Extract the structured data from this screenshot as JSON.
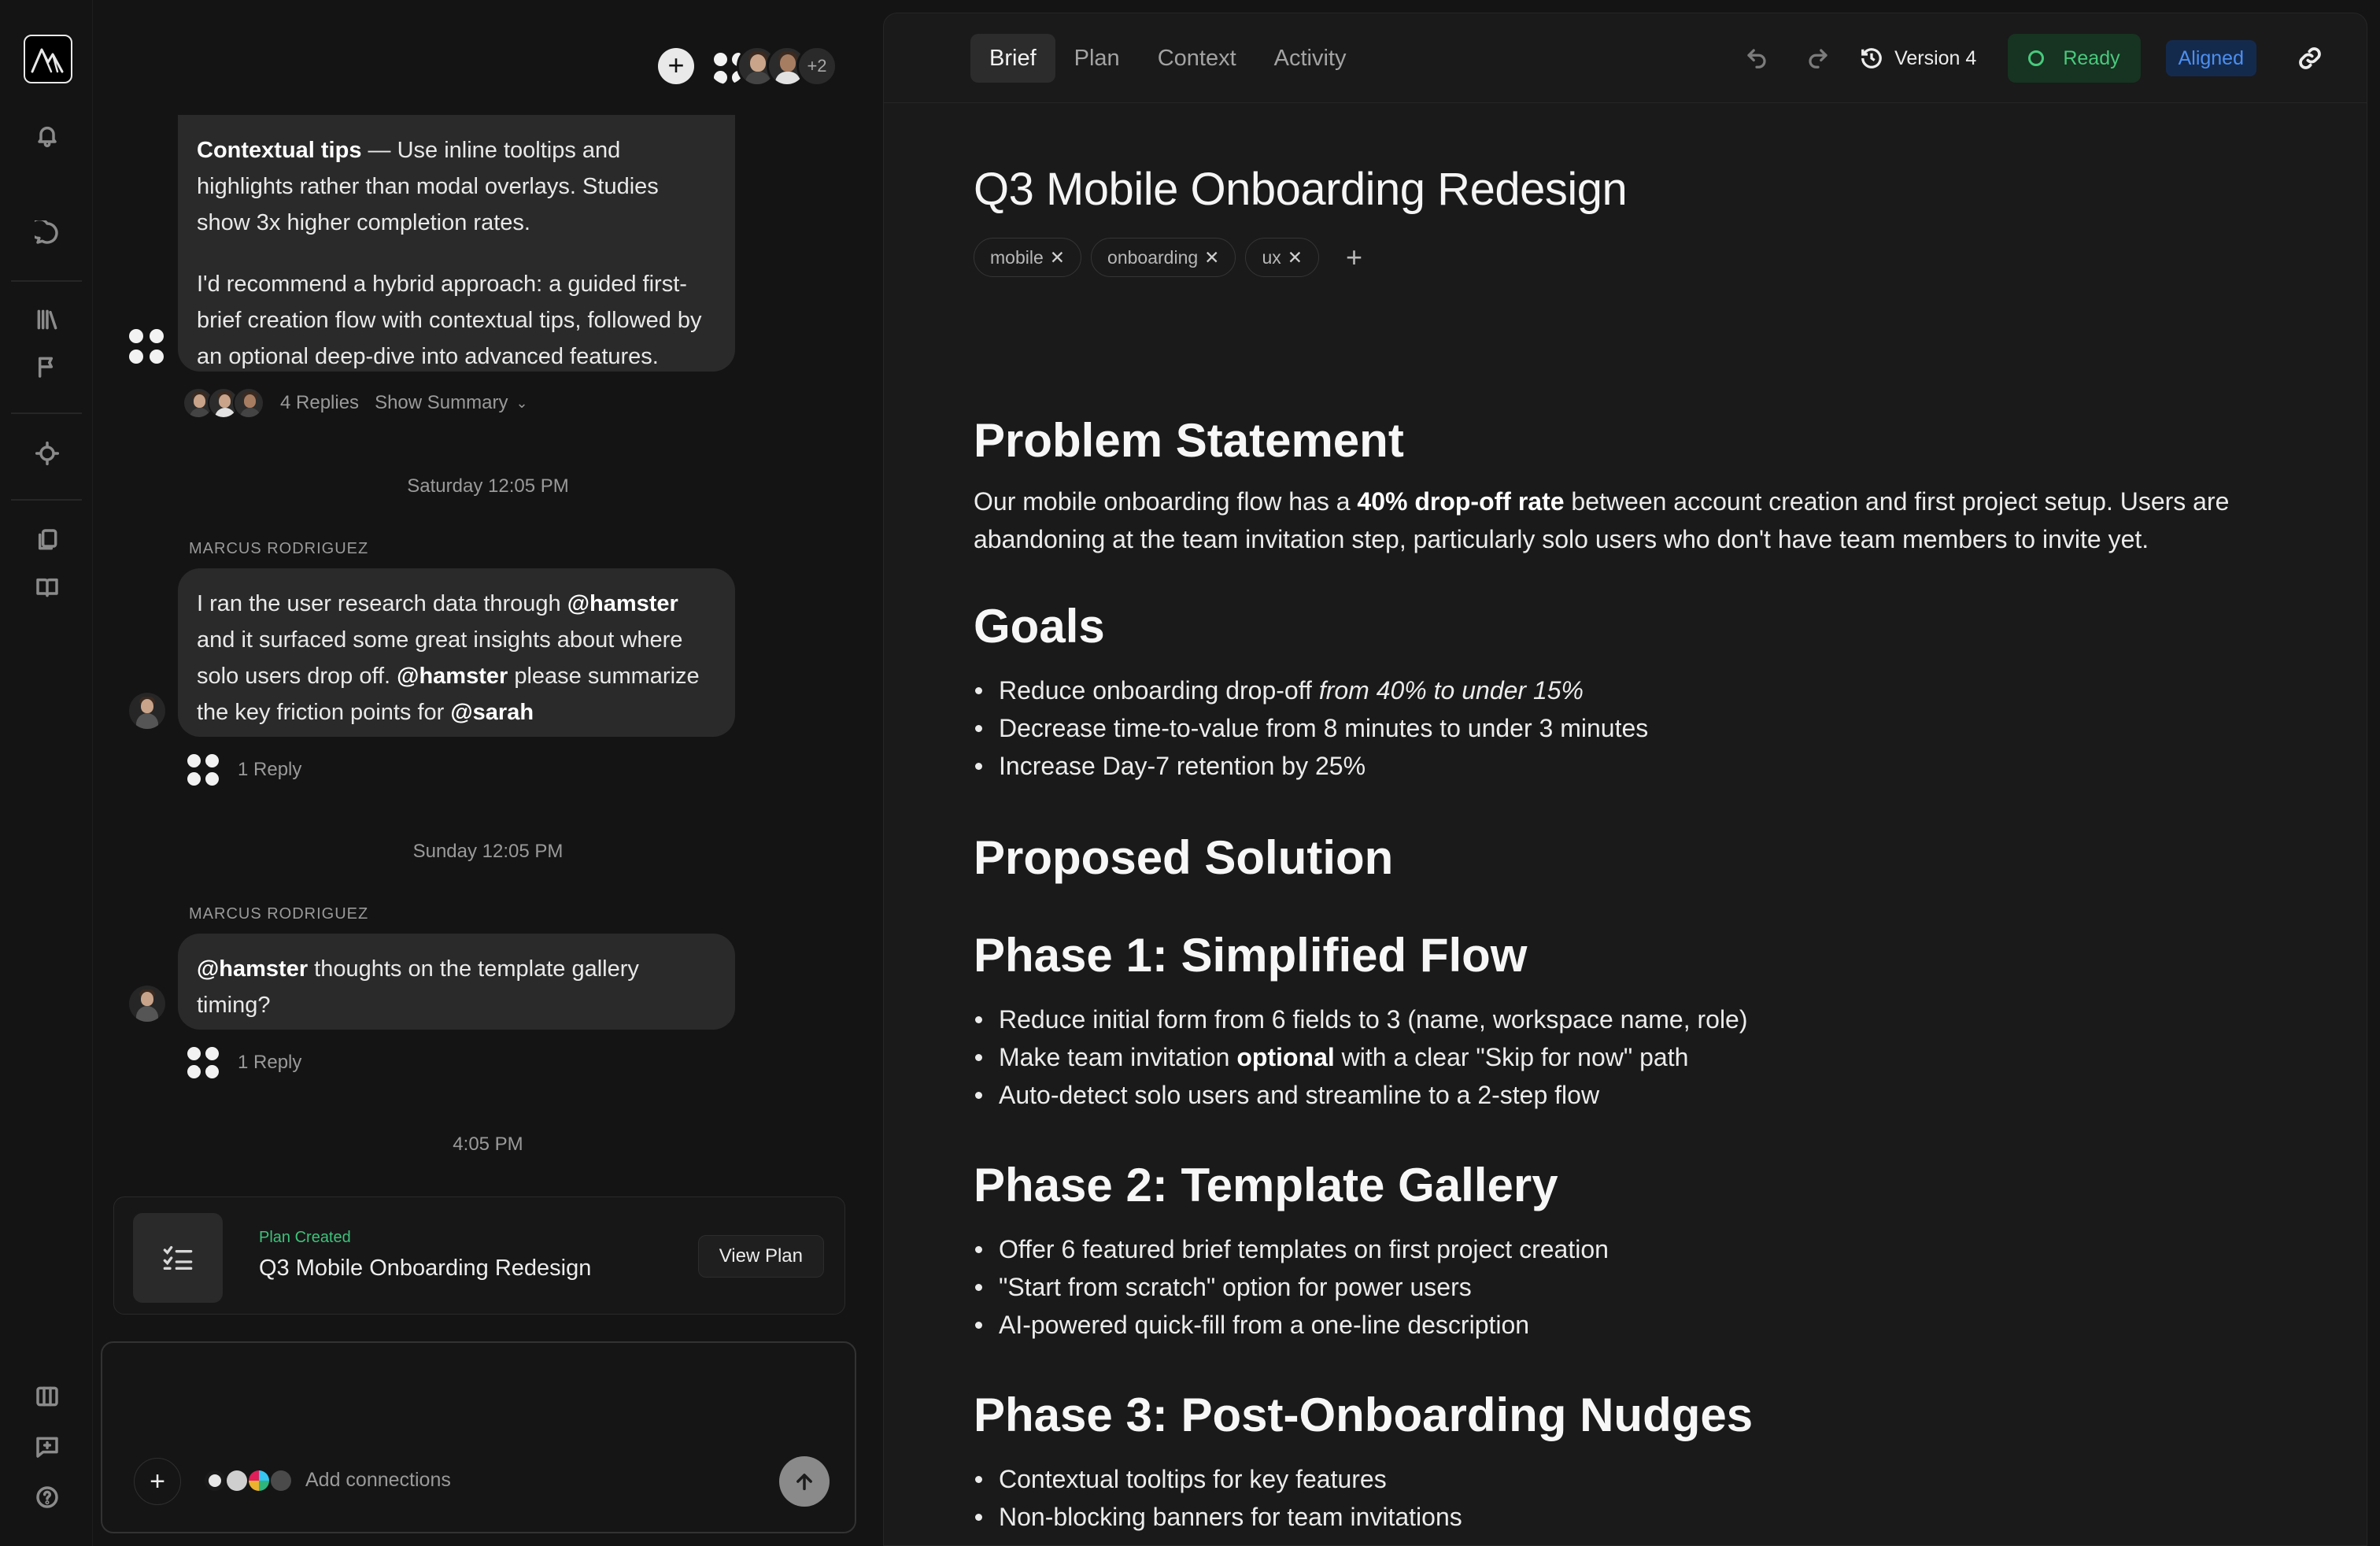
{
  "chat": {
    "extra_collaborators": "+2",
    "messages": [
      {
        "p1_bold": "Contextual tips",
        "p1_rest": " — Use inline tooltips and highlights rather than modal overlays. Studies show 3x higher completion rates.",
        "p2": "I'd recommend a hybrid approach: a guided first-brief creation flow with contextual tips, followed by an optional deep-dive into advanced features.",
        "replies": "4 Replies",
        "summary": "Show Summary"
      }
    ],
    "date1": "Saturday 12:05 PM",
    "sender1": "MARCUS RODRIGUEZ",
    "msg2": {
      "t1": "I ran the user research data through ",
      "m1": "@hamster",
      "t2": " and it surfaced some great insights about where solo users drop off. ",
      "m2": "@hamster",
      "t3": " please summarize the key friction points for ",
      "m3": "@sarah"
    },
    "reply2": "1 Reply",
    "date2": "Sunday 12:05 PM",
    "sender2": "MARCUS RODRIGUEZ",
    "msg3": {
      "m1": "@hamster",
      "t1": " thoughts on the template gallery timing?"
    },
    "reply3": "1 Reply",
    "date3": "4:05 PM",
    "plan_card": {
      "kicker": "Plan Created",
      "title": "Q3 Mobile Onboarding Redesign",
      "button": "View Plan"
    },
    "composer": {
      "placeholder": "Add connections"
    }
  },
  "doc": {
    "tabs": [
      "Brief",
      "Plan",
      "Context",
      "Activity"
    ],
    "version": "Version 4",
    "status": "Ready",
    "alignment": "Aligned",
    "title": "Q3 Mobile Onboarding Redesign",
    "tags": [
      "mobile",
      "onboarding",
      "ux"
    ],
    "problem": {
      "heading": "Problem Statement",
      "t1": "Our mobile onboarding flow has a ",
      "b1": "40% drop-off rate",
      "t2": " between account creation and first project setup. Users are abandoning at the team invitation step, particularly solo users who don't have team members to invite yet."
    },
    "goals": {
      "heading": "Goals",
      "g1a": "Reduce onboarding drop-off ",
      "g1b": "from 40% to under 15%",
      "g2": "Decrease time-to-value from 8 minutes to under 3 minutes",
      "g3": "Increase Day-7 retention by 25%"
    },
    "solution_heading": "Proposed Solution",
    "phase1": {
      "heading": "Phase 1: Simplified Flow",
      "i1": "Reduce initial form from 6 fields to 3 (name, workspace name, role)",
      "i2a": "Make team invitation ",
      "i2b": "optional",
      "i2c": " with a clear \"Skip for now\" path",
      "i3": "Auto-detect solo users and streamline to a 2-step flow"
    },
    "phase2": {
      "heading": "Phase 2: Template Gallery",
      "i1": "Offer 6 featured brief templates on first project creation",
      "i2": "\"Start from scratch\" option for power users",
      "i3": "AI-powered quick-fill from a one-line description"
    },
    "phase3": {
      "heading": "Phase 3: Post-Onboarding Nudges",
      "i1": "Contextual tooltips for key features",
      "i2": "Non-blocking banners for team invitations"
    }
  }
}
